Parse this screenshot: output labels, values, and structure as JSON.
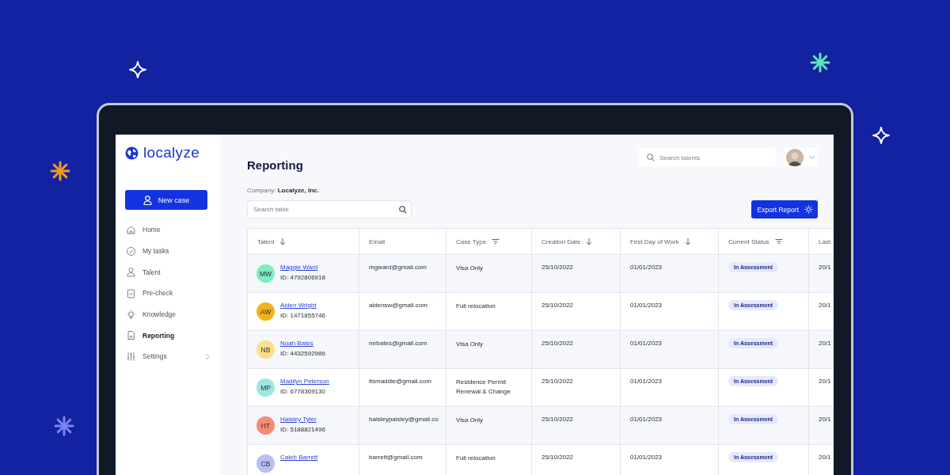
{
  "app": {
    "logo": "localyze",
    "new_case_button": "New case"
  },
  "sidebar": {
    "items": [
      {
        "label": "Home",
        "selected": false,
        "kind": "link"
      },
      {
        "label": "My tasks",
        "selected": false,
        "kind": "link"
      },
      {
        "label": "Talent",
        "selected": false,
        "kind": "link"
      },
      {
        "label": "Pre-check",
        "selected": false,
        "kind": "link"
      },
      {
        "label": "Knowledge",
        "selected": false,
        "kind": "link"
      },
      {
        "label": "Reporting",
        "selected": true,
        "kind": "link"
      },
      {
        "label": "Settings",
        "selected": false,
        "kind": "submenu"
      }
    ]
  },
  "header": {
    "title": "Reporting",
    "search": {
      "placeholder": "Search talents"
    }
  },
  "company": {
    "label": "Company:",
    "value": "Localyze, Inc."
  },
  "table_search": {
    "placeholder": "Search table"
  },
  "export_button": "Export Report",
  "table": {
    "columns": [
      {
        "label": "Talent",
        "kind": "sort"
      },
      {
        "label": "Email",
        "kind": "plain"
      },
      {
        "label": "Case Type",
        "kind": "filter"
      },
      {
        "label": "Creation Date",
        "kind": "sort"
      },
      {
        "label": "First Day of Work",
        "kind": "sort"
      },
      {
        "label": "Current Status",
        "kind": "filter"
      },
      {
        "label": "Last",
        "kind": "plain"
      }
    ],
    "rows": [
      {
        "initials": "MW",
        "color": "#7eecc0",
        "name": "Maggie Ward",
        "id": "ID: 4792806918",
        "email": "mgward@gmail.com",
        "case_type": "Visa Only",
        "creation_date": "25/10/2022",
        "first_day": "01/01/2023",
        "status": "In Assessment",
        "last": "20/1"
      },
      {
        "initials": "AW",
        "color": "#f2b21c",
        "name": "Aiden Wright",
        "id": "ID: 1471855746",
        "email": "aidensw@gmail.com",
        "case_type": "Full relocation",
        "creation_date": "25/10/2022",
        "first_day": "01/01/2023",
        "status": "In Assessment",
        "last": "20/1"
      },
      {
        "initials": "NB",
        "color": "#fbe08a",
        "name": "Noah Bates",
        "id": "ID: 4432592986",
        "email": "mrbates@gmail.com",
        "case_type": "Visa Only",
        "creation_date": "25/10/2022",
        "first_day": "01/01/2023",
        "status": "In Assessment",
        "last": "20/1"
      },
      {
        "initials": "MP",
        "color": "#9fe6e0",
        "name": "Madilyn Peterson",
        "id": "ID: 6778369130",
        "email": "itsmaddie@gmail.com",
        "case_type": "Residence Permit Renewal & Change",
        "creation_date": "25/10/2022",
        "first_day": "01/01/2023",
        "status": "In Assessment",
        "last": "20/1"
      },
      {
        "initials": "HT",
        "color": "#f78a76",
        "name": "Haisley Tyler",
        "id": "ID: 5188821496",
        "email": "haisleypaisley@gmail.co",
        "case_type": "Visa Only",
        "creation_date": "25/10/2022",
        "first_day": "01/01/2023",
        "status": "In Assessment",
        "last": "20/1"
      },
      {
        "initials": "CB",
        "color": "#b7bff4",
        "name": "Caleb Barrett",
        "email": "barrett@gmail.com",
        "case_type": "Full relocation",
        "creation_date": "25/10/2022",
        "first_day": "01/01/2023",
        "status": "In Assessment",
        "last": "20/1"
      }
    ]
  }
}
